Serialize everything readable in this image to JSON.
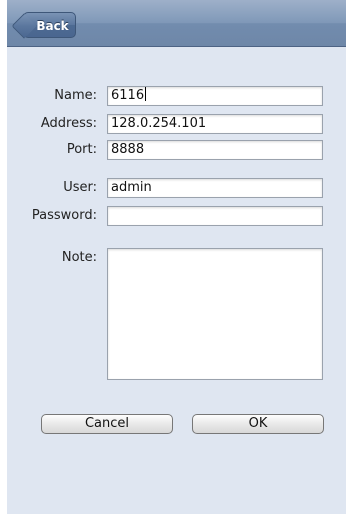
{
  "navbar": {
    "back_label": "Back"
  },
  "form": {
    "name": {
      "label": "Name:",
      "value": "6116"
    },
    "address": {
      "label": "Address:",
      "value": "128.0.254.101"
    },
    "port": {
      "label": "Port:",
      "value": "8888"
    },
    "user": {
      "label": "User:",
      "value": "admin"
    },
    "password": {
      "label": "Password:",
      "value": ""
    },
    "note": {
      "label": "Note:",
      "value": ""
    }
  },
  "buttons": {
    "cancel": "Cancel",
    "ok": "OK"
  }
}
